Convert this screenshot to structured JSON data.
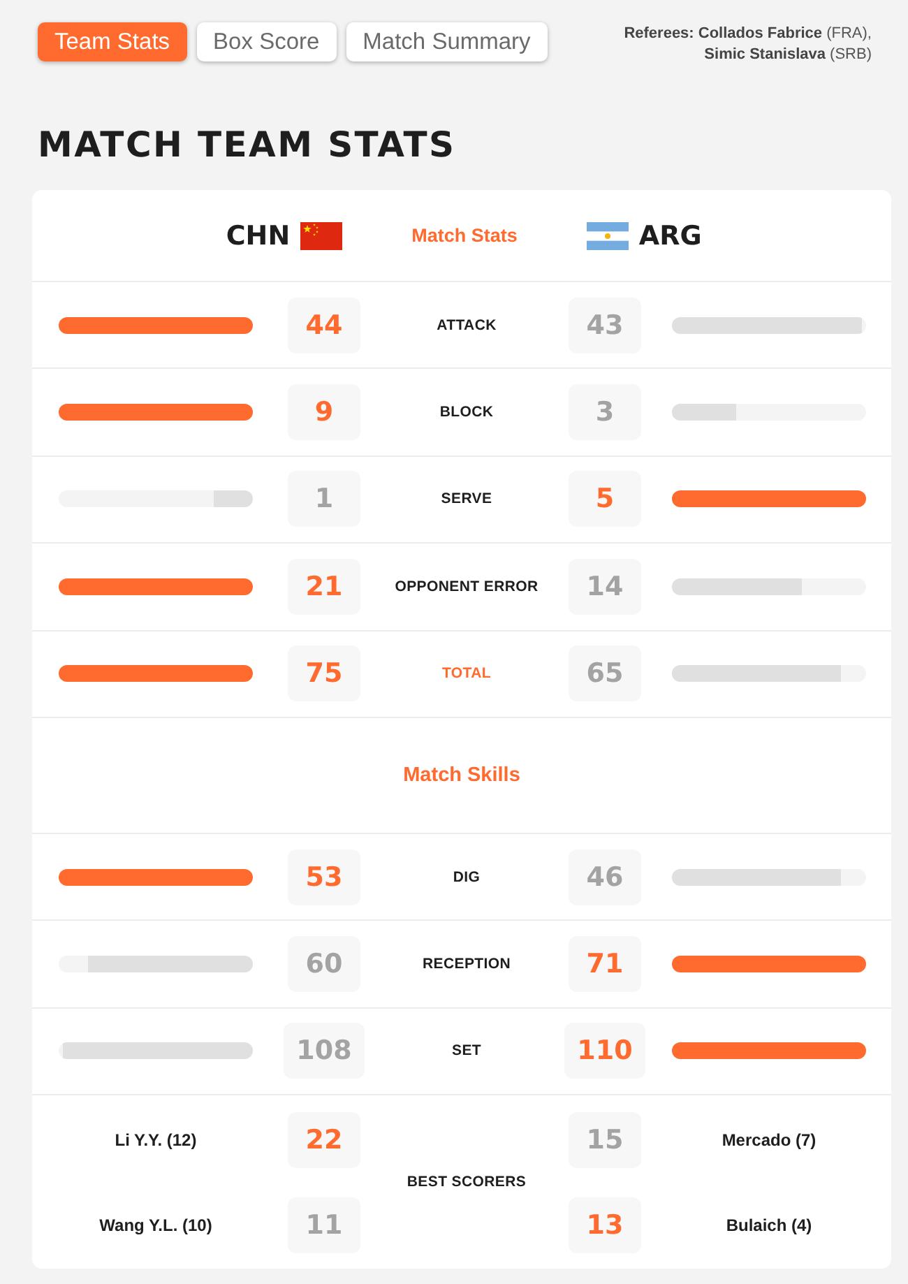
{
  "tabs": [
    {
      "label": "Team Stats",
      "selected": true
    },
    {
      "label": "Box Score",
      "selected": false
    },
    {
      "label": "Match Summary",
      "selected": false
    }
  ],
  "referees": [
    "**Referees: Collados Fabrice** (FRA),",
    "**Simic Stanislava** (SRB)"
  ],
  "title": "MATCH TEAM STATS",
  "teams": {
    "home": "CHN",
    "away": "ARG"
  },
  "sections": [
    {
      "kind": "team_header",
      "title": "Match Stats",
      "rows": [
        {
          "kind": "bar",
          "label": "ATTACK",
          "highlighted": false,
          "home": {
            "value": "44",
            "leading": true
          },
          "away": {
            "value": "43",
            "leading": false,
            "level": 0.98
          }
        },
        {
          "kind": "bar",
          "label": "BLOCK",
          "highlighted": false,
          "home": {
            "value": "9",
            "leading": true
          },
          "away": {
            "value": "3",
            "leading": false,
            "level": 0.33
          }
        },
        {
          "kind": "bar",
          "label": "SERVE",
          "highlighted": false,
          "home": {
            "value": "1",
            "leading": false,
            "level": 0.2
          },
          "away": {
            "value": "5",
            "leading": true
          }
        },
        {
          "kind": "bar",
          "label": "OPPONENT ERROR",
          "highlighted": false,
          "home": {
            "value": "21",
            "leading": true
          },
          "away": {
            "value": "14",
            "leading": false,
            "level": 0.67
          }
        },
        {
          "kind": "bar",
          "label": "TOTAL",
          "highlighted": true,
          "home": {
            "value": "75",
            "leading": true
          },
          "away": {
            "value": "65",
            "leading": false,
            "level": 0.87
          }
        }
      ]
    },
    {
      "kind": "title",
      "title": "Match Skills",
      "rows": [
        {
          "kind": "bar",
          "label": "DIG",
          "highlighted": false,
          "home": {
            "value": "53",
            "leading": true
          },
          "away": {
            "value": "46",
            "leading": false,
            "level": 0.87
          }
        },
        {
          "kind": "bar",
          "label": "RECEPTION",
          "highlighted": false,
          "home": {
            "value": "60",
            "leading": false,
            "level": 0.85
          },
          "away": {
            "value": "71",
            "leading": true
          }
        },
        {
          "kind": "bar",
          "label": "SET",
          "highlighted": false,
          "home": {
            "value": "108",
            "leading": false,
            "level": 0.98
          },
          "away": {
            "value": "110",
            "leading": true
          }
        },
        {
          "kind": "scorers",
          "label": "BEST SCORERS",
          "highlighted": false,
          "pairs": [
            {
              "home": {
                "name": "Li Y.Y. (12)",
                "value": "22",
                "leading": true
              },
              "away": {
                "name": "Mercado (7)",
                "value": "15",
                "leading": false
              }
            },
            {
              "home": {
                "name": "Wang Y.L. (10)",
                "value": "11",
                "leading": false
              },
              "away": {
                "name": "Bulaich (4)",
                "value": "13",
                "leading": true
              }
            }
          ]
        }
      ]
    }
  ]
}
